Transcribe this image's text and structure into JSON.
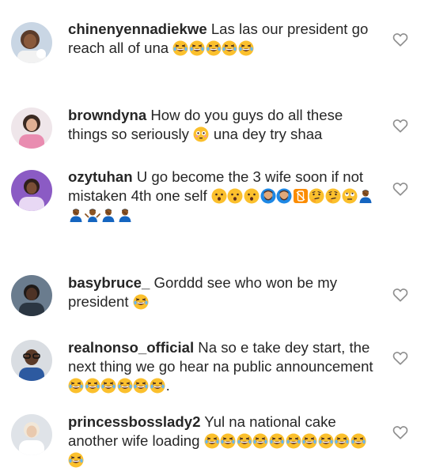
{
  "comments": [
    {
      "username": "chinenyennadiekwe",
      "text": "Las las our president go reach all of una",
      "emojis": [
        "laughing",
        "laughing",
        "laughing",
        "laughing",
        "laughing"
      ],
      "avatar": "avatar-girl-face-icon",
      "avatar_bg": "#c9d6e4"
    },
    {
      "username": "browndyna",
      "text": "How do you guys do all these things so seriously",
      "inline_emoji": "flushed",
      "text_after": "una dey try shaa",
      "avatar": "avatar-woman-pink-icon",
      "avatar_bg": "#e8b7c8"
    },
    {
      "username": "ozytuhan",
      "text": "U go become the 3 wife soon if not mistaken 4th one self",
      "emojis": [
        "hushed",
        "hushed",
        "hushed",
        "man-beard",
        "man-beard",
        "mobile-phone-off",
        "thinking",
        "thinking",
        "rolling-eyes",
        "person-facepalming",
        "person-facepalming",
        "person-shrugging",
        "person-facepalming",
        "person-facepalming"
      ],
      "avatar": "avatar-purple-selfie-icon",
      "avatar_bg": "#8b5bc4"
    },
    {
      "username": "basybruce_",
      "text": "Gorddd see who won be my president",
      "emojis": [
        "laughing"
      ],
      "avatar": "avatar-man-dark-icon",
      "avatar_bg": "#6a7c8e"
    },
    {
      "username": "realnonso_official",
      "text": "Na so e take dey start, the next thing we go hear na public announcement",
      "emojis": [
        "laughing",
        "laughing",
        "laughing",
        "laughing",
        "laughing",
        "laughing"
      ],
      "text_after": ".",
      "avatar": "avatar-man-glasses-icon",
      "avatar_bg": "#d9dde2"
    },
    {
      "username": "princessbosslady2",
      "text": "Yul na national cake another wife loading",
      "emojis": [
        "laughing",
        "laughing",
        "laughing",
        "laughing",
        "laughing",
        "laughing",
        "laughing",
        "laughing",
        "laughing",
        "laughing",
        "laughing"
      ],
      "avatar": "avatar-woman-white-icon",
      "avatar_bg": "#dfe3e8"
    }
  ],
  "colors": {
    "text": "#262626",
    "heart_outline": "#8e8e8e",
    "emoji_yellow": "#fbc02d"
  }
}
